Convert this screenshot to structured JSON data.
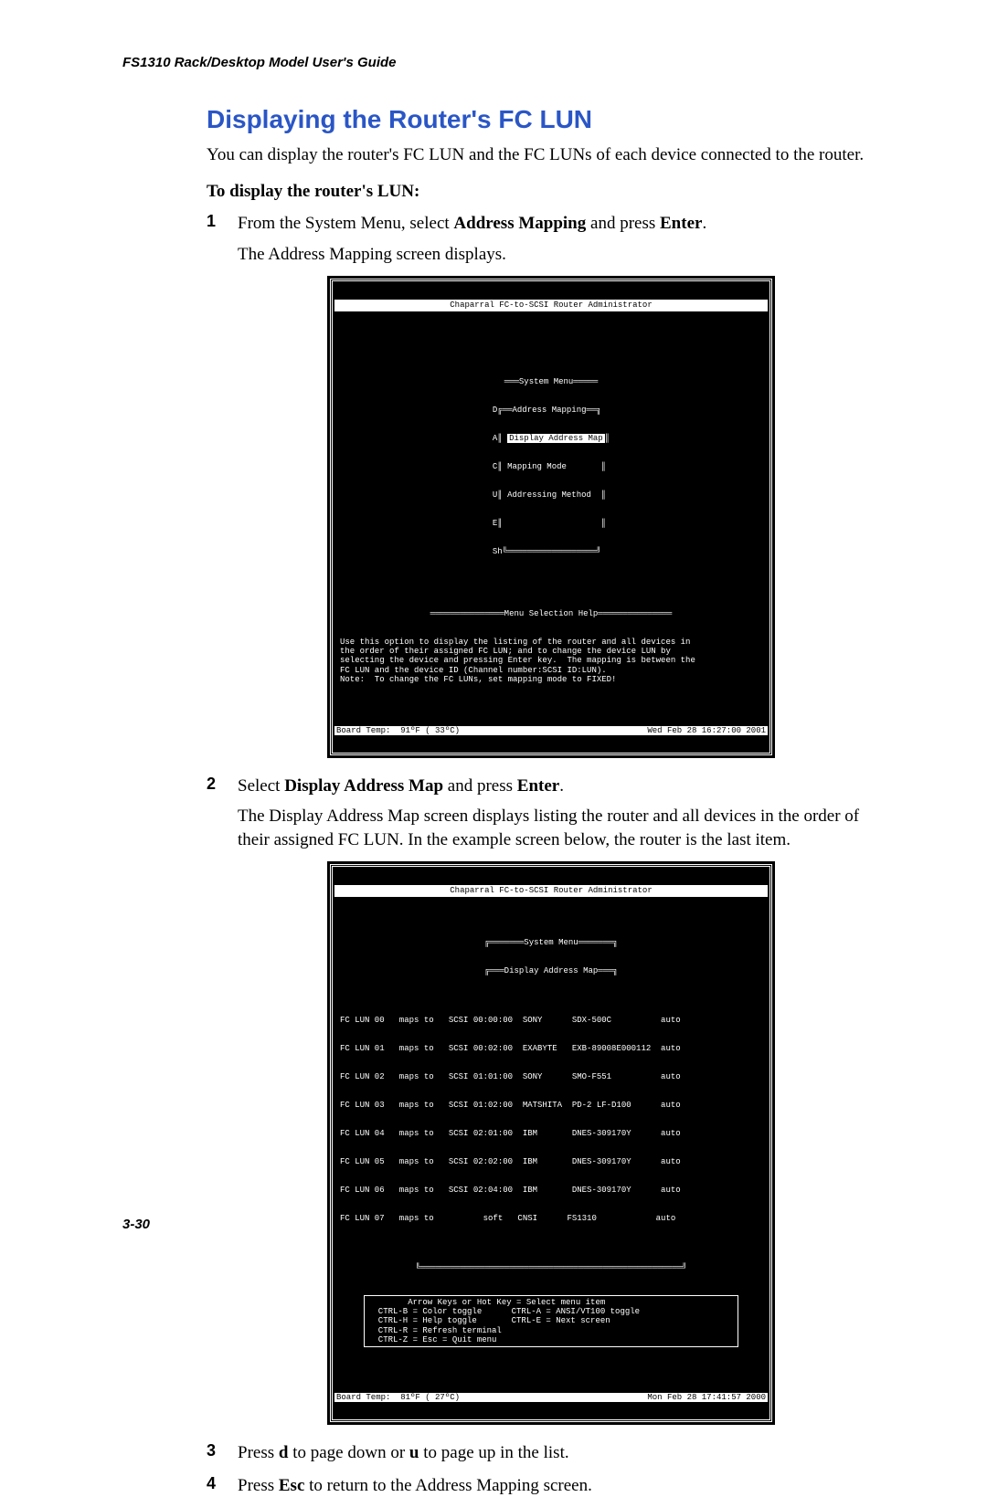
{
  "header": "FS1310 Rack/Desktop Model User's Guide",
  "title": "Displaying the Router's FC LUN",
  "intro": "You can display the router's FC LUN and the FC LUNs of each device connected to the router.",
  "sub_heading": "To display the router's LUN:",
  "steps": {
    "s1": {
      "num": "1",
      "line1_pre": "From the System Menu, select ",
      "line1_b1": "Address Mapping",
      "line1_mid": " and press ",
      "line1_b2": "Enter",
      "line1_post": ".",
      "line2": "The Address Mapping screen displays."
    },
    "s2": {
      "num": "2",
      "line1_pre": "Select ",
      "line1_b1": "Display Address Map",
      "line1_mid": " and press ",
      "line1_b2": "Enter",
      "line1_post": ".",
      "line2": "The Display Address Map screen displays listing the router and all devices in the order of their assigned FC LUN. In the example screen below, the router is the last item."
    },
    "s3": {
      "num": "3",
      "pre": "Press ",
      "b1": "d",
      "mid": " to page down or ",
      "b2": "u",
      "post": " to page up in the list."
    },
    "s4": {
      "num": "4",
      "pre": "Press ",
      "b1": "Esc",
      "post": " to return to the Address Mapping screen."
    }
  },
  "term1": {
    "title": "Chaparral FC-to-SCSI Router Administrator",
    "menu_title": "═══System Menu═════",
    "sub_title": "══Address Mapping══",
    "left_letters": [
      "D",
      "A",
      "C",
      "U",
      "E",
      "Sh"
    ],
    "items": [
      "Display Address Map",
      "Mapping Mode",
      "Addressing Method"
    ],
    "help_title": "═══════════════Menu Selection Help═══════════════",
    "help_body": "Use this option to display the listing of the router and all devices in\nthe order of their assigned FC LUN; and to change the device LUN by\nselecting the device and pressing Enter key.  The mapping is between the\nFC LUN and the device ID (Channel number:SCSI ID:LUN).\nNote:  To change the FC LUNs, set mapping mode to FIXED!",
    "footer_left": "Board Temp:  91ºF ( 33ºC)",
    "footer_right": "Wed Feb 28 16:27:00 2001"
  },
  "term2": {
    "title": "Chaparral FC-to-SCSI Router Administrator",
    "menu_title": "═══════System Menu═══════",
    "map_title": "═══Display Address Map═══",
    "rows": [
      "FC LUN 00   maps to   SCSI 00:00:00  SONY      SDX-500C          auto",
      "FC LUN 01   maps to   SCSI 00:02:00  EXABYTE   EXB-89008E000112  auto",
      "FC LUN 02   maps to   SCSI 01:01:00  SONY      SMO-F551          auto",
      "FC LUN 03   maps to   SCSI 01:02:00  MATSHITA  PD-2 LF-D100      auto",
      "FC LUN 04   maps to   SCSI 02:01:00  IBM       DNES-309170Y      auto",
      "FC LUN 05   maps to   SCSI 02:02:00  IBM       DNES-309170Y      auto",
      "FC LUN 06   maps to   SCSI 02:04:00  IBM       DNES-309170Y      auto",
      "FC LUN 07   maps to          soft   CNSI      FS1310            auto"
    ],
    "help_body": "        Arrow Keys or Hot Key = Select menu item\n  CTRL-B = Color toggle      CTRL-A = ANSI/VT100 toggle\n  CTRL-H = Help toggle       CTRL-E = Next screen\n  CTRL-R = Refresh terminal\n  CTRL-Z = Esc = Quit menu",
    "footer_left": "Board Temp:  81ºF ( 27ºC)",
    "footer_right": "Mon Feb 28 17:41:57 2000"
  },
  "page_number": "3-30"
}
